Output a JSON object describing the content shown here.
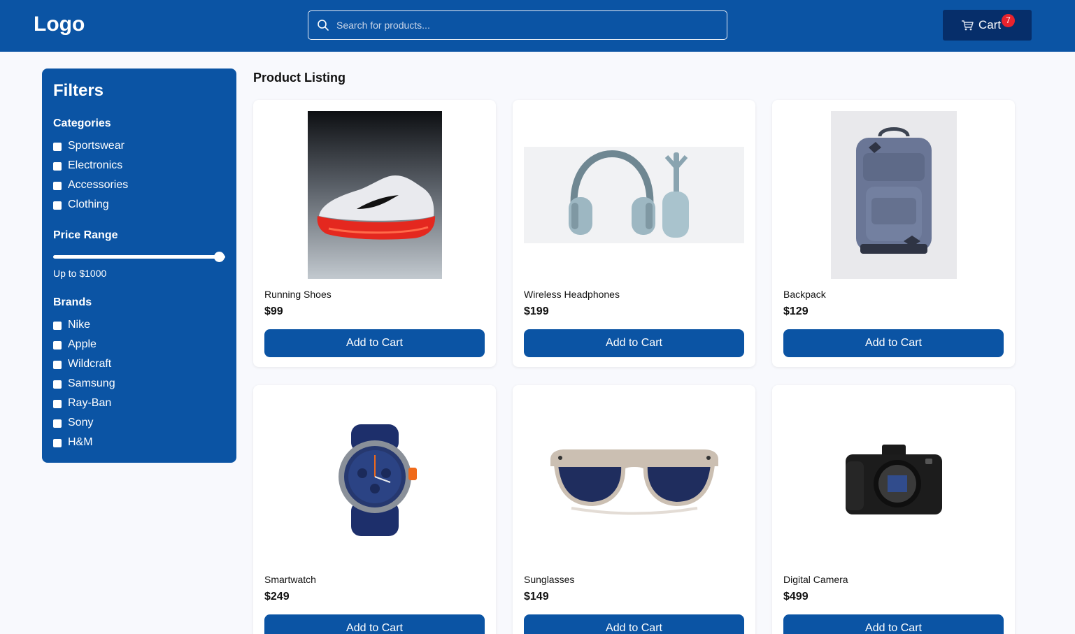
{
  "header": {
    "logo": "Logo",
    "search_placeholder": "Search for products...",
    "cart_label": "Cart",
    "cart_count": "7"
  },
  "sidebar": {
    "title": "Filters",
    "categories_title": "Categories",
    "categories": [
      "Sportswear",
      "Electronics",
      "Accessories",
      "Clothing"
    ],
    "price_title": "Price Range",
    "price_label": "Up to $1000",
    "price_max_value": 1000,
    "price_slider_fraction": 1.0,
    "brands_title": "Brands",
    "brands": [
      "Nike",
      "Apple",
      "Wildcraft",
      "Samsung",
      "Ray-Ban",
      "Sony",
      "H&M"
    ]
  },
  "main": {
    "title": "Product Listing",
    "products": [
      {
        "name": "Running Shoes",
        "price": "$99",
        "button": "Add to Cart",
        "icon": "running-shoe-image"
      },
      {
        "name": "Wireless Headphones",
        "price": "$199",
        "button": "Add to Cart",
        "icon": "headphones-image"
      },
      {
        "name": "Backpack",
        "price": "$129",
        "button": "Add to Cart",
        "icon": "backpack-image"
      },
      {
        "name": "Smartwatch",
        "price": "$249",
        "button": "Add to Cart",
        "icon": "smartwatch-image"
      },
      {
        "name": "Sunglasses",
        "price": "$149",
        "button": "Add to Cart",
        "icon": "sunglasses-image"
      },
      {
        "name": "Digital Camera",
        "price": "$499",
        "button": "Add to Cart",
        "icon": "camera-image"
      }
    ]
  },
  "colors": {
    "brand": "#0b54a4",
    "cart_button": "#062e6a",
    "badge": "#e8232d",
    "page_bg": "#f8f9fd"
  }
}
